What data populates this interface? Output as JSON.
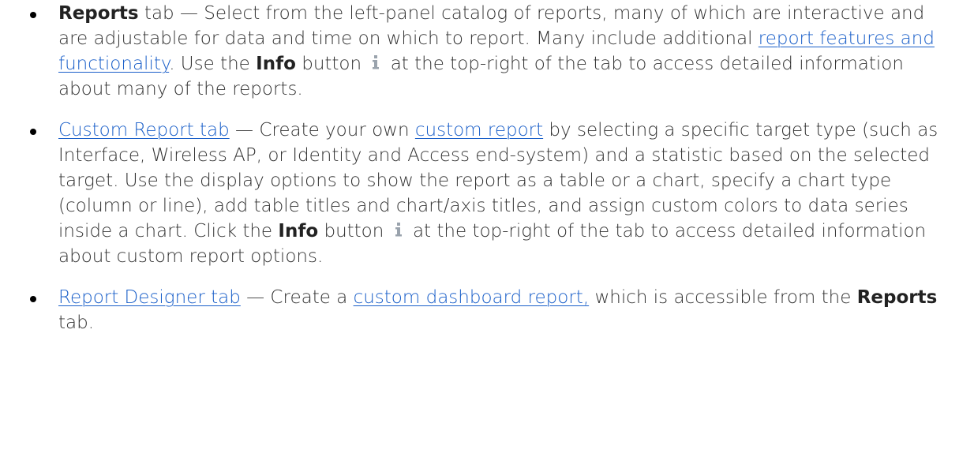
{
  "items": [
    {
      "title": "Reports",
      "text1": " tab — Select from the left-panel catalog of reports, many of which are interactive and are adjustable for data and time on which to report. Many include additional ",
      "link1": "report features and functionality",
      "text2": ". Use the ",
      "bold2": "Info",
      "text3": " button ",
      "text4": " at the top-right of the tab to access detailed information about many of the reports."
    },
    {
      "link_title": "Custom Report tab",
      "text1": " — Create your own ",
      "link1": "custom report",
      "text2": " by selecting a specific target type (such as Interface, Wireless AP, or Identity and Access end-system) and a statistic based on the selected target. Use the display options to show the report as a table or a chart, specify a chart type (column or line), add table titles and chart/axis titles, and assign custom colors to data series inside a chart. Click the ",
      "bold2": "Info",
      "text3": " button ",
      "text4": " at the top-right of the tab to access detailed information about custom report options."
    },
    {
      "link_title": "Report Designer tab",
      "text1": " — Create a ",
      "link1": "custom dashboard report,",
      "text2": " which is accessible from the ",
      "bold2": "Reports",
      "text3": " tab."
    }
  ],
  "icons": {
    "info": "info-icon",
    "info_color": "#b0b7c0"
  },
  "colors": {
    "link": "#1a5fc9",
    "text": "#333333"
  }
}
